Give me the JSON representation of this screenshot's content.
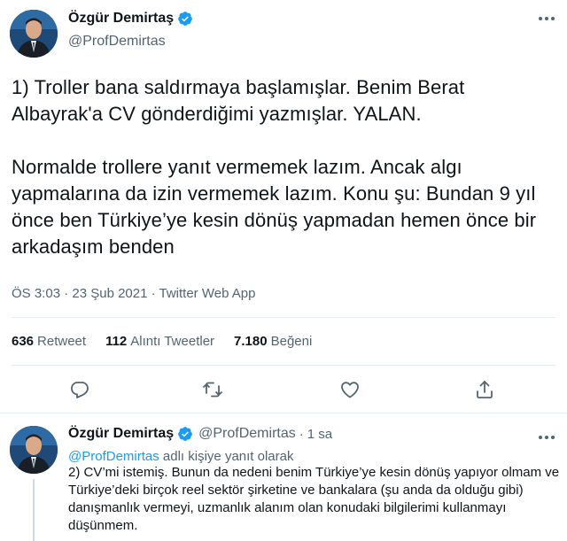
{
  "main_tweet": {
    "display_name": "Özgür Demirtaş",
    "handle": "@ProfDemirtas",
    "text": "1) Troller bana saldırmaya başlamışlar. Benim Berat Albayrak'a CV gönderdiğimi yazmışlar. YALAN.\n\nNormalde trollere yanıt vermemek lazım. Ancak algı yapmalarına da izin vermemek lazım. Konu şu: Bundan 9 yıl önce ben Türkiye’ye kesin dönüş yapmadan hemen önce bir arkadaşım benden",
    "meta": "ÖS 3:03 · 23 Şub 2021 · Twitter Web App",
    "stats": [
      {
        "count": "636",
        "label": "Retweet"
      },
      {
        "count": "112",
        "label": "Alıntı Tweetler"
      },
      {
        "count": "7.180",
        "label": "Beğeni"
      }
    ]
  },
  "reply_tweet": {
    "display_name": "Özgür Demirtaş",
    "handle": "@ProfDemirtas",
    "dot": "·",
    "time": "1 sa",
    "reply_mention": "@ProfDemirtas",
    "reply_suffix": " adlı kişiye yanıt olarak",
    "text": "2) CV’mi istemiş. Bunun da nedeni benim Türkiye’ye kesin dönüş yapıyor olmam ve Türkiye’deki birçok reel sektör şirketine ve  bankalara (şu anda da olduğu gibi) danışmanlık vermeyi, uzmanlık alanım olan konudaki bilgilerimi kullanmayı düşünmem."
  },
  "icons": {
    "verified": "verified-badge-icon",
    "more": "more-options-icon",
    "reply": "reply-icon",
    "retweet": "retweet-icon",
    "like": "heart-icon",
    "share": "share-icon"
  },
  "colors": {
    "accent": "#1d9bf0",
    "text": "#0f1419",
    "secondary": "#536471",
    "divider": "#e6ecf0"
  }
}
